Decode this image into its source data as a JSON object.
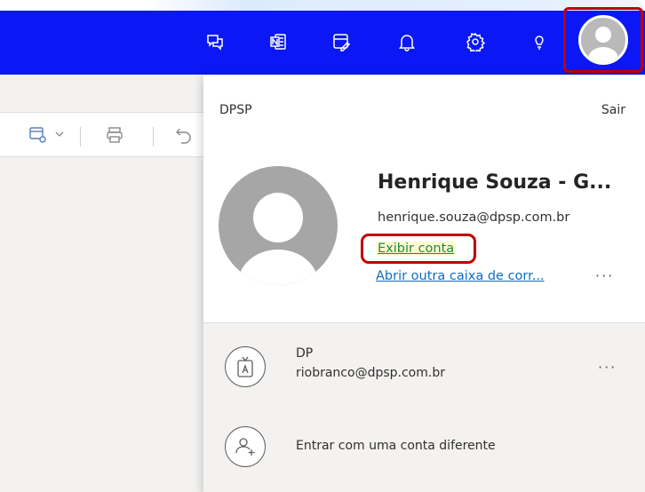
{
  "colors": {
    "header_bg": "#0b18f5",
    "highlight_red": "#c00000",
    "link_blue": "#0f6cbd",
    "link_green": "#1a8a47"
  },
  "header": {
    "icons": [
      "chat-icon",
      "onenote-icon",
      "task-edit-icon",
      "bell-icon",
      "gear-icon",
      "lightbulb-icon",
      "avatar-icon"
    ]
  },
  "toolbar": {
    "icons": [
      "card-settings-icon",
      "chevron-down-icon",
      "print-icon",
      "undo-icon"
    ]
  },
  "account": {
    "org": "DPSP",
    "sign_out": "Sair",
    "name": "Henrique Souza - G...",
    "email": "henrique.souza@dpsp.com.br",
    "view_account": "Exibir conta",
    "open_other_mailbox": "Abrir outra caixa de corr...",
    "more": "···"
  },
  "other_accounts": [
    {
      "name": "DP",
      "email": "riobranco@dpsp.com.br",
      "more": "···",
      "icon": "badge-icon"
    }
  ],
  "sign_in_other": {
    "label": "Entrar com uma conta diferente",
    "icon": "add-person-icon"
  }
}
